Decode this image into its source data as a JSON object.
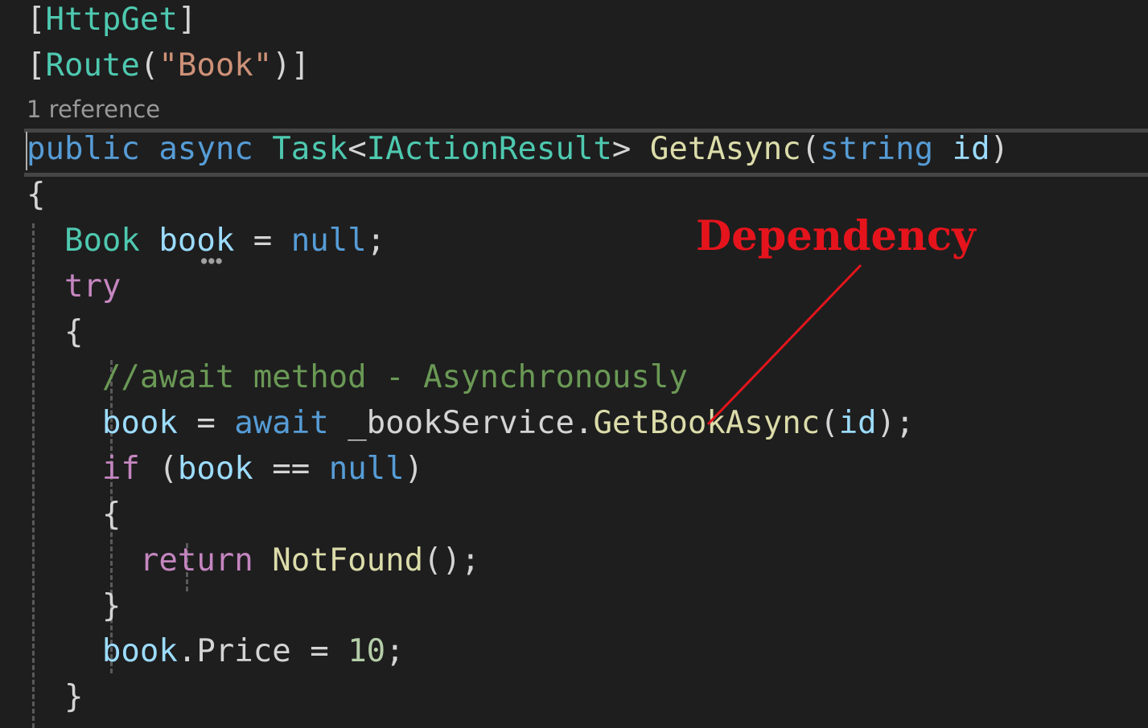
{
  "code": {
    "line1": {
      "open": "[",
      "attr": "HttpGet",
      "close": "]"
    },
    "line2": {
      "open": "[",
      "attr": "Route",
      "lparen": "(",
      "str": "\"Book\"",
      "rparen": ")",
      "close": "]"
    },
    "codelens": "1 reference",
    "line3": {
      "public": "public",
      "async": "async",
      "task": "Task",
      "lt": "<",
      "iface": "IActionResult",
      "gt": ">",
      "name": "GetAsync",
      "lparen": "(",
      "string": "string",
      "param": "id",
      "rparen": ")"
    },
    "line4": {
      "brace": "{"
    },
    "line5": {
      "type": "Book",
      "var": "book",
      "eq": "=",
      "null": "null",
      "semi": ";"
    },
    "line6": {
      "try": "try"
    },
    "line7": {
      "brace": "{"
    },
    "line8": {
      "comment": "//await method - Asynchronously"
    },
    "line9": {
      "var": "book",
      "eq": "=",
      "await": "await",
      "field": "_bookService",
      "dot": ".",
      "method": "GetBookAsync",
      "lparen": "(",
      "param": "id",
      "rparen": ")",
      "semi": ";"
    },
    "line10": {
      "if": "if",
      "lparen": "(",
      "var": "book",
      "op": "==",
      "null": "null",
      "rparen": ")"
    },
    "line11": {
      "brace": "{"
    },
    "line12": {
      "return": "return",
      "method": "NotFound",
      "parens": "()",
      "semi": ";"
    },
    "line13": {
      "brace": "}"
    },
    "line14": {
      "var": "book",
      "dot": ".",
      "prop": "Price",
      "eq": "=",
      "num": "10",
      "semi": ";"
    },
    "line15": {
      "brace": "}"
    }
  },
  "annotation": {
    "label": "Dependency",
    "color": "#e5141c"
  },
  "colors": {
    "background": "#1e1e1e",
    "keyword": "#569cd6",
    "control": "#c586c0",
    "type": "#4ec9b0",
    "method": "#dcdcaa",
    "variable": "#9cdcfe",
    "string": "#ce9178",
    "number": "#b5cea8",
    "comment": "#6a9955"
  }
}
